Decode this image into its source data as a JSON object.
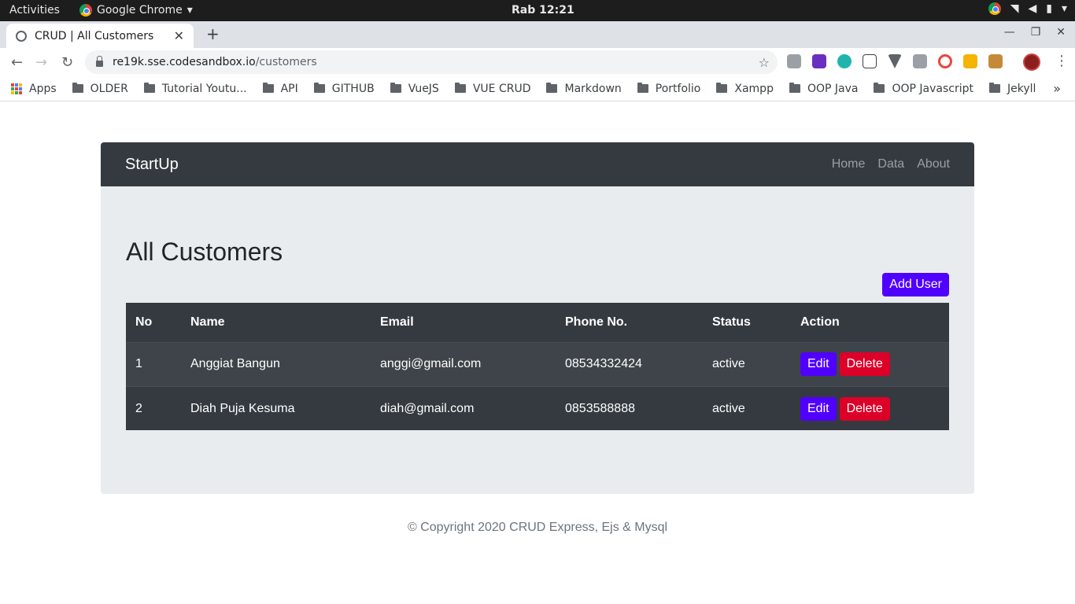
{
  "os": {
    "activities": "Activities",
    "app_name": "Google Chrome",
    "clock": "Rab 12:21"
  },
  "browser": {
    "tab_title": "CRUD | All Customers",
    "url_host": "re19k.sse.codesandbox.io",
    "url_path": "/customers",
    "bookmarks": [
      "Apps",
      "OLDER",
      "Tutorial Youtu...",
      "API",
      "GITHUB",
      "VueJS",
      "VUE CRUD",
      "Markdown",
      "Portfolio",
      "Xampp",
      "OOP Java",
      "OOP Javascript",
      "Jekyll"
    ]
  },
  "page": {
    "brand": "StartUp",
    "nav": [
      "Home",
      "Data",
      "About"
    ],
    "title": "All Customers",
    "add_user_label": "Add User",
    "table": {
      "headers": [
        "No",
        "Name",
        "Email",
        "Phone No.",
        "Status",
        "Action"
      ],
      "rows": [
        {
          "no": "1",
          "name": "Anggiat Bangun",
          "email": "anggi@gmail.com",
          "phone": "08534332424",
          "status": "active"
        },
        {
          "no": "2",
          "name": "Diah Puja Kesuma",
          "email": "diah@gmail.com",
          "phone": "0853588888",
          "status": "active"
        }
      ],
      "edit_label": "Edit",
      "delete_label": "Delete"
    },
    "footer": "© Copyright 2020 CRUD Express, Ejs & Mysql"
  },
  "colors": {
    "navbar": "#343a40",
    "container": "#e9ecef",
    "primary": "#5000ff",
    "danger": "#dc0029"
  }
}
